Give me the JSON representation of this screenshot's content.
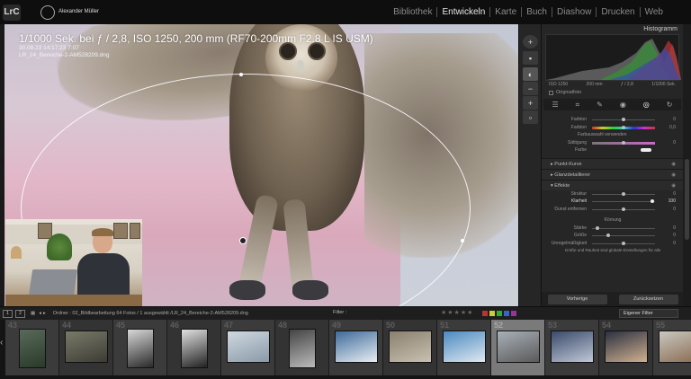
{
  "topbar": {
    "logo": "LrC",
    "identity_name": "Alexander Müller",
    "modules": [
      "Bibliothek",
      "Entwickeln",
      "Karte",
      "Buch",
      "Diashow",
      "Drucken",
      "Web"
    ],
    "active_module": "Entwickeln"
  },
  "overlay": {
    "line1": "1/1000 Sek. bei ƒ / 2,8, ISO 1250, 200 mm (RF70-200mm F2.8 L IS USM)",
    "line2": "30.08.23 14:17:23 7:07",
    "line3": "LR_24_Bereiche-2-AM528209.dng"
  },
  "histogram": {
    "title": "Histogramm",
    "iso": "ISO 1250",
    "focal": "200 mm",
    "aperture": "ƒ / 2,8",
    "shutter": "1/1000 Sek.",
    "original_photo": "Originalfoto"
  },
  "panel": {
    "rows_top": [
      {
        "label": "Farbton",
        "value": "0"
      },
      {
        "label": "Farbton",
        "value": "0,0"
      },
      {
        "label": "Farbauswahl verwenden",
        "value": ""
      },
      {
        "label": "Sättigung",
        "value": "0"
      },
      {
        "label": "Farbe",
        "value": ""
      }
    ],
    "sections": [
      {
        "label": "Punkt-Kurve"
      },
      {
        "label": "Glanzdetaillierer"
      },
      {
        "label": "Effekte"
      }
    ],
    "effect_rows": [
      {
        "label": "Struktur",
        "value": "0"
      },
      {
        "label": "Klarheit",
        "value": "100"
      },
      {
        "label": "Dunst entfernen",
        "value": "0"
      }
    ],
    "kornung": "Körnung",
    "grain_rows": [
      {
        "label": "Stärke",
        "value": "0"
      },
      {
        "label": "Größe",
        "value": "0"
      },
      {
        "label": "Unregelmäßigkeit",
        "value": "0"
      }
    ],
    "hint": "Größe und Rauheit sind globale Einstellungen für alle",
    "prev_button": "Vorherige",
    "reset_button": "Zurücksetzen"
  },
  "filterbar": {
    "view1": "1",
    "view2": "2",
    "path": "Ordner : 02_Bildbearbeitung  64 Fotos / 1 ausgewählt /LR_24_Bereiche-2-AM528209.dng",
    "filter_label": "Filter :",
    "stars": "★★★★★",
    "preset": "Eigener Filter"
  },
  "filmstrip": {
    "numbers": [
      "43",
      "44",
      "45",
      "46",
      "47",
      "48",
      "49",
      "50",
      "51",
      "52",
      "53",
      "54",
      "55"
    ],
    "selected_index": 9
  }
}
